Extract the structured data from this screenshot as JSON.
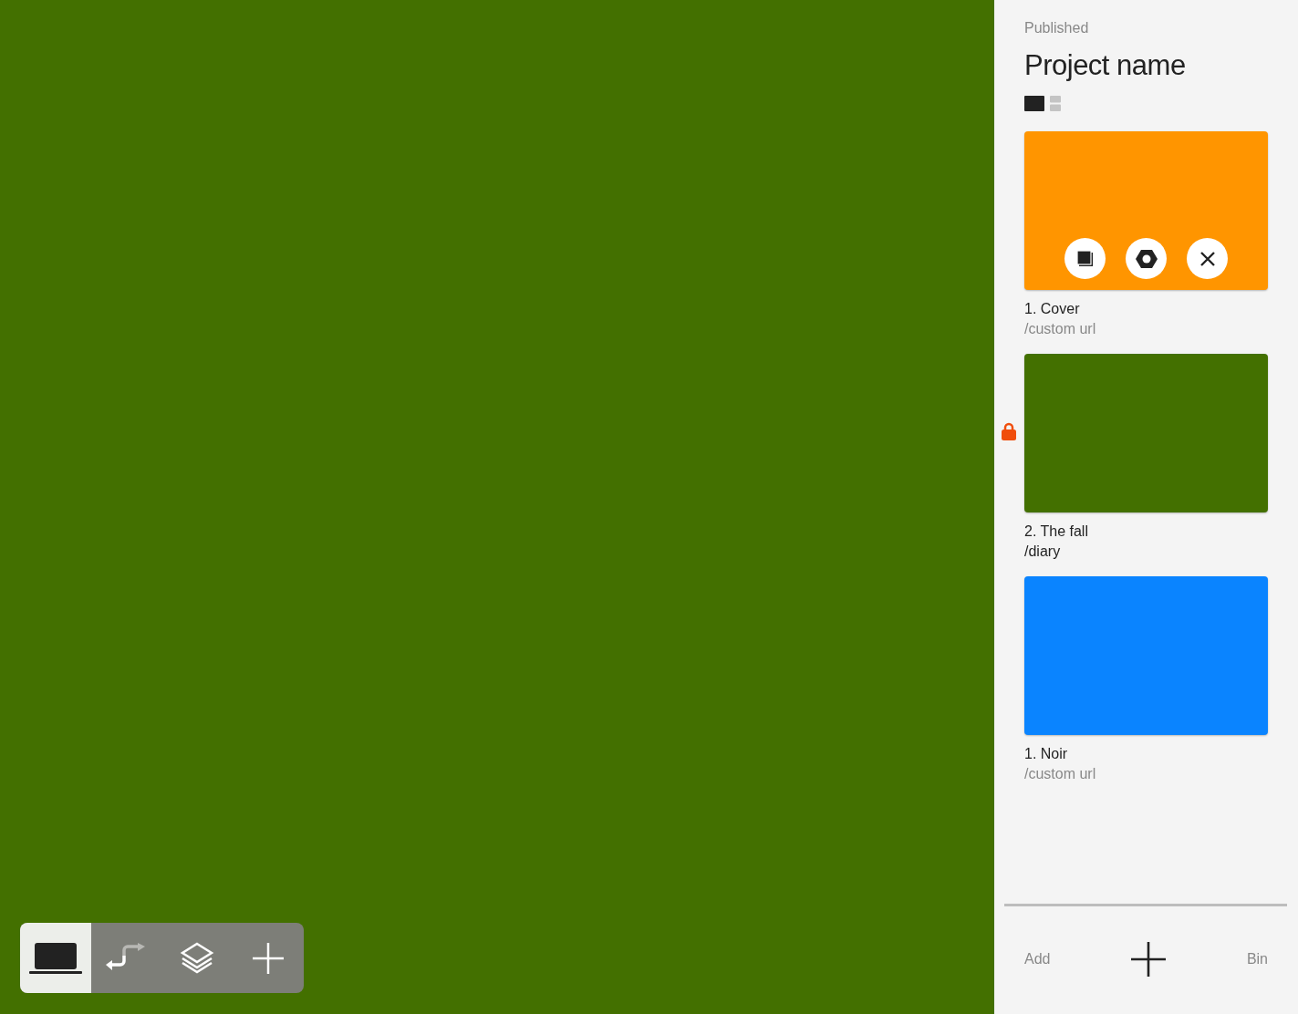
{
  "canvas": {
    "color": "#437000"
  },
  "toolbar": [
    {
      "kind": "device",
      "selected": true
    },
    {
      "kind": "flow",
      "selected": false
    },
    {
      "kind": "layers",
      "selected": false
    },
    {
      "kind": "add",
      "selected": false
    }
  ],
  "sidebar": {
    "status": "Published",
    "title": "Project name",
    "view_modes": [
      {
        "kind": "large",
        "selected": true
      },
      {
        "kind": "list",
        "selected": false
      }
    ],
    "pages": [
      {
        "title": "1. Cover",
        "url": "/custom url",
        "url_muted": true,
        "color": "#ff9500",
        "locked": false,
        "hovered": true
      },
      {
        "title": "2. The fall",
        "url": "/diary",
        "url_muted": false,
        "color": "#437000",
        "locked": true,
        "hovered": false
      },
      {
        "title": "1. Noir",
        "url": "/custom url",
        "url_muted": true,
        "color": "#0a84ff",
        "locked": false,
        "hovered": false
      }
    ],
    "footer": {
      "add_label": "Add",
      "bin_label": "Bin"
    }
  }
}
